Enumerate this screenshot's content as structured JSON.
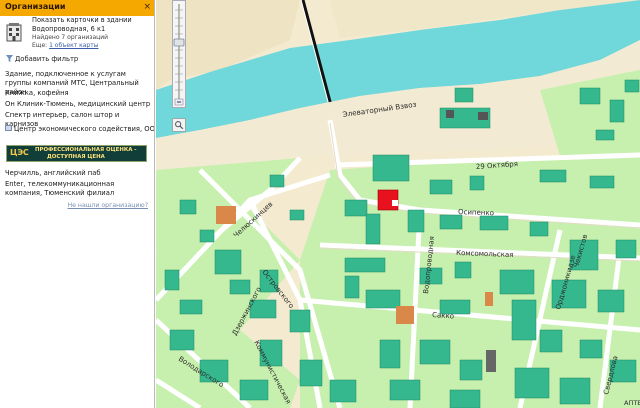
{
  "panel": {
    "title": "Организации",
    "card": {
      "line1": "Показать карточки в здании",
      "line2": "Водопроводная, 6 к1",
      "line3": "Найдено 7 организаций",
      "line4_prefix": "Еще: ",
      "line4_link": "1 объект карты"
    },
    "filter_label": "Добавить фильтр",
    "orgs": [
      "Здание, подключенное к услугам группы компаний МТС, Центральный район",
      "Книжка, кофейня",
      "Он Клиник-Тюмень, медицинский центр",
      "Спектр интерьер, салон штор и карнизов",
      "Центр экономического содействия, ООО",
      "Черчилль, английский паб",
      "Enter, телекоммуникационная компания, Тюменский филиал"
    ],
    "banner": {
      "logo": "ЦЭС",
      "line1": "ПРОФЕССИОНАЛЬНАЯ ОЦЕНКА -",
      "line2": "ДОСТУПНАЯ ЦЕНА"
    },
    "not_found_link": "Не нашли организацию?"
  },
  "map": {
    "streets": {
      "elevator": "Элеваторный Взвоз",
      "oct29": "29 Октября",
      "osipenko": "Осипенко",
      "komsomolskaya": "Комсомольская",
      "sakko": "Сакко",
      "vodoprovodnaya": "Водопроводная",
      "ordzhonikidze": "Орджоникидзе",
      "chekistov": "Чекистов",
      "sverdlova": "Свердлова",
      "chelyuskintsev": "Челюскинцев",
      "ostrovskogo": "Островского",
      "dzerzhinskogo": "Дзержинского",
      "volodarskogo": "Володарского",
      "kommunisticheskaya": "Коммунистическая",
      "edge": "АПТЕ"
    }
  },
  "colors": {
    "header": "#f5a800",
    "water": "#70d7da",
    "land": "#f4ead0",
    "green": "#c7f0ae",
    "building": "#35b88e",
    "selected": "#e8121e",
    "orange_building": "#d9884a"
  }
}
